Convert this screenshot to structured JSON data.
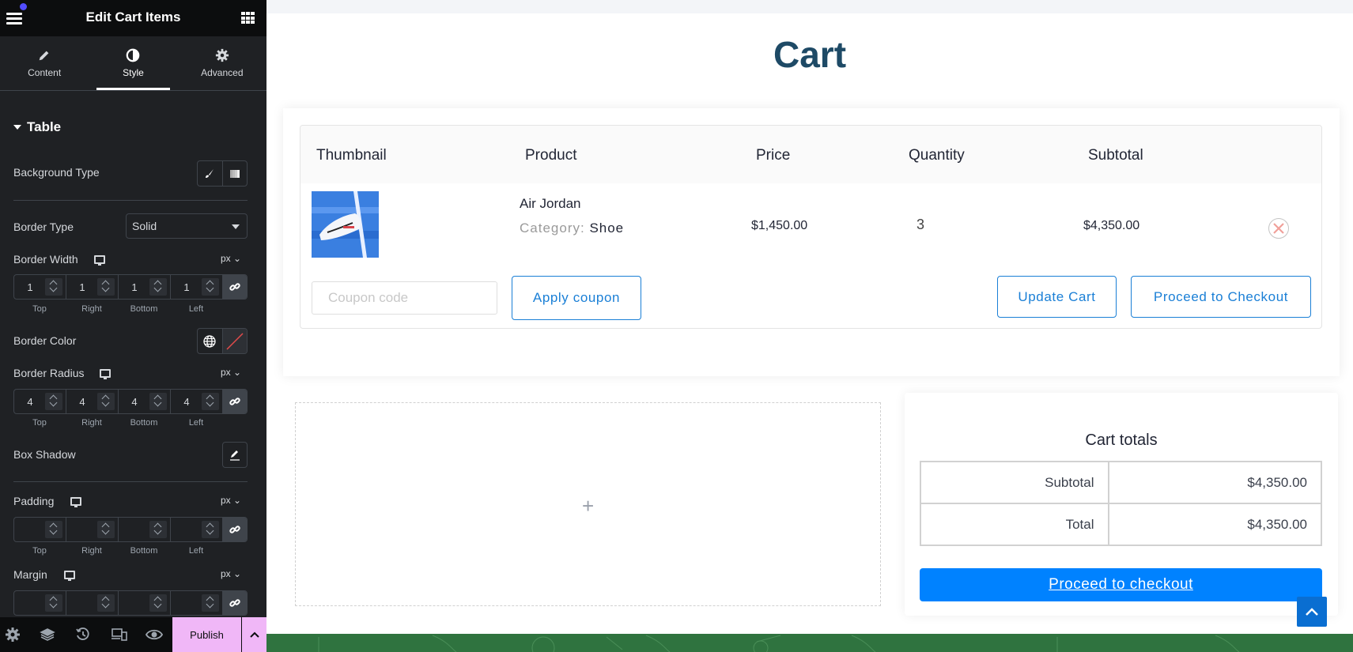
{
  "editor": {
    "title": "Edit Cart Items",
    "tabs": [
      {
        "label": "Content",
        "icon": "pencil-icon",
        "active": false
      },
      {
        "label": "Style",
        "icon": "contrast-icon",
        "active": true
      },
      {
        "label": "Advanced",
        "icon": "gear-icon",
        "active": false
      }
    ],
    "section": {
      "label": "Table",
      "expanded": true
    },
    "controls": {
      "background_type": {
        "label": "Background Type",
        "options": [
          "classic",
          "gradient"
        ]
      },
      "border_type": {
        "label": "Border Type",
        "value": "Solid"
      },
      "border_width": {
        "label": "Border Width",
        "unit": "px",
        "values": [
          "1",
          "1",
          "1",
          "1"
        ]
      },
      "border_color": {
        "label": "Border Color",
        "value": "none"
      },
      "border_radius": {
        "label": "Border Radius",
        "unit": "px",
        "values": [
          "4",
          "4",
          "4",
          "4"
        ]
      },
      "box_shadow": {
        "label": "Box Shadow"
      },
      "padding": {
        "label": "Padding",
        "unit": "px",
        "values": [
          "",
          "",
          "",
          ""
        ]
      },
      "margin": {
        "label": "Margin",
        "unit": "px",
        "values": [
          "",
          "",
          "",
          ""
        ]
      },
      "dimension_labels": [
        "Top",
        "Right",
        "Bottom",
        "Left"
      ]
    },
    "footer": {
      "icons": [
        "settings-icon",
        "layers-icon",
        "history-icon",
        "responsive-icon",
        "preview-icon"
      ],
      "publish_label": "Publish"
    },
    "accent_publish": "#f0b7f7"
  },
  "page": {
    "title": "Cart",
    "table": {
      "headers": [
        "Thumbnail",
        "Product",
        "Price",
        "Quantity",
        "Subtotal"
      ],
      "rows": [
        {
          "product": "Air Jordan",
          "category_label": "Category:",
          "category": "Shoe",
          "price": "$1,450.00",
          "quantity": "3",
          "subtotal": "$4,350.00"
        }
      ]
    },
    "coupon": {
      "placeholder": "Coupon code",
      "value": ""
    },
    "buttons": {
      "apply_coupon": "Apply coupon",
      "update_cart": "Update Cart",
      "proceed_checkout": "Proceed to Checkout"
    },
    "totals": {
      "title": "Cart totals",
      "rows": [
        {
          "label": "Subtotal",
          "value": "$4,350.00"
        },
        {
          "label": "Total",
          "value": "$4,350.00"
        }
      ],
      "checkout_label": "Proceed to checkout"
    },
    "colors": {
      "title": "#1e4a66",
      "outline_button": "#1a7fd6",
      "checkout_button": "#0082ff",
      "footer": "#2f733f"
    }
  }
}
